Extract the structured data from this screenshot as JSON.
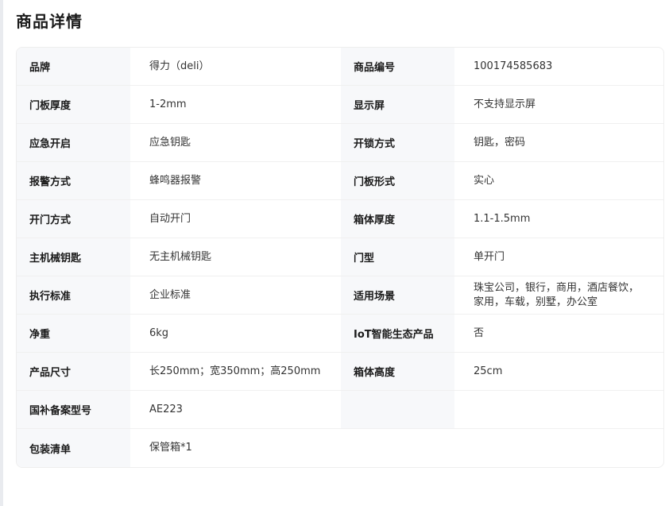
{
  "page": {
    "title": "商品详情"
  },
  "specs": [
    {
      "left_label": "品牌",
      "left_value": "得力（deli）",
      "right_label": "商品编号",
      "right_value": "100174585683"
    },
    {
      "left_label": "门板厚度",
      "left_value": "1-2mm",
      "right_label": "显示屏",
      "right_value": "不支持显示屏"
    },
    {
      "left_label": "应急开启",
      "left_value": "应急钥匙",
      "right_label": "开锁方式",
      "right_value": "钥匙，密码"
    },
    {
      "left_label": "报警方式",
      "left_value": "蜂鸣器报警",
      "right_label": "门板形式",
      "right_value": "实心"
    },
    {
      "left_label": "开门方式",
      "left_value": "自动开门",
      "right_label": "箱体厚度",
      "right_value": "1.1-1.5mm"
    },
    {
      "left_label": "主机械钥匙",
      "left_value": "无主机械钥匙",
      "right_label": "门型",
      "right_value": "单开门"
    },
    {
      "left_label": "执行标准",
      "left_value": "企业标准",
      "right_label": "适用场景",
      "right_value": "珠宝公司，银行，商用，酒店餐饮，家用，车载，别墅，办公室"
    },
    {
      "left_label": "净重",
      "left_value": "6kg",
      "right_label": "IoT智能生态产品",
      "right_value": "否"
    },
    {
      "left_label": "产品尺寸",
      "left_value": "长250mm；宽350mm；高250mm",
      "right_label": "箱体高度",
      "right_value": "25cm"
    },
    {
      "left_label": "国补备案型号",
      "left_value": "AE223",
      "right_label": "",
      "right_value": ""
    },
    {
      "left_label": "包装清单",
      "left_value": "保管箱*1"
    }
  ]
}
